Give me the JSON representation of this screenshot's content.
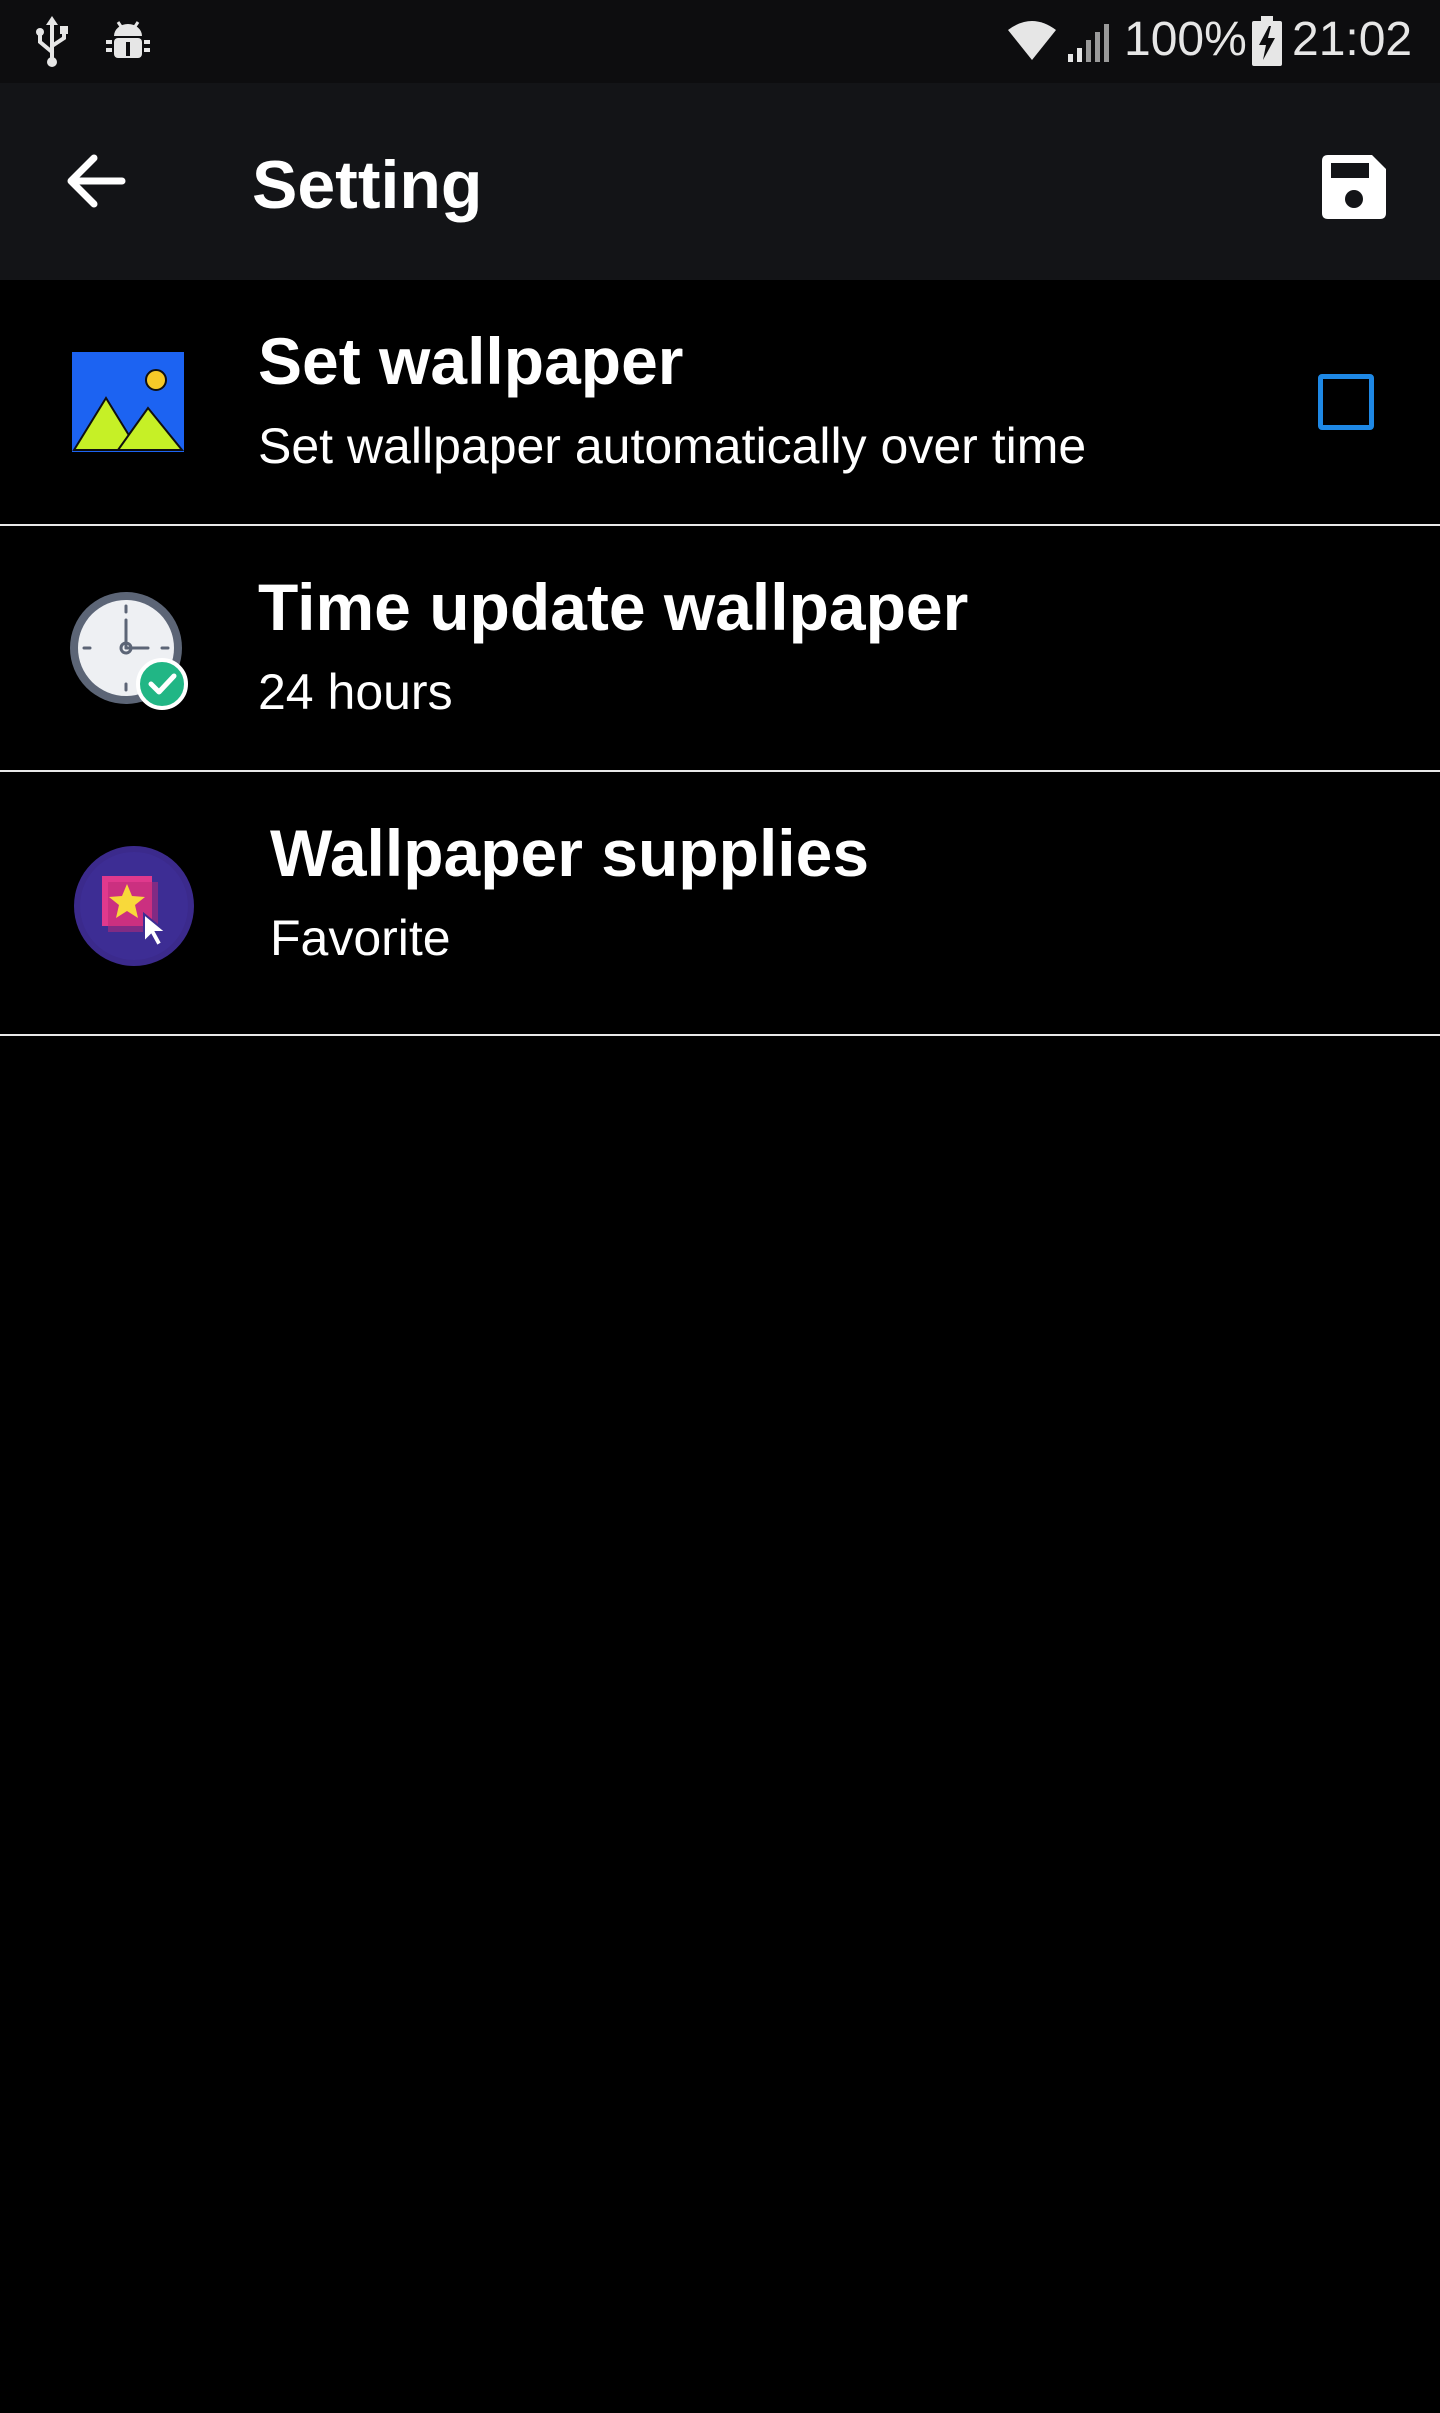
{
  "status_bar": {
    "left_icons": [
      "usb-icon",
      "android-debug-icon"
    ],
    "right_icons": [
      "wifi-icon",
      "signal-icon",
      "battery-charging-icon"
    ],
    "battery": "100%",
    "time": "21:02"
  },
  "app_bar": {
    "title": "Setting",
    "back_icon": "arrow-left-icon",
    "save_icon": "floppy-disk-icon"
  },
  "settings": [
    {
      "id": "set-wallpaper",
      "icon": "picture-landscape-icon",
      "title": "Set wallpaper",
      "subtitle": "Set wallpaper automatically over time",
      "checked": false
    },
    {
      "id": "time-update",
      "icon": "clock-check-icon",
      "title": "Time update wallpaper",
      "subtitle": "24 hours"
    },
    {
      "id": "wallpaper-supplies",
      "icon": "star-picture-cursor-icon",
      "title": "Wallpaper supplies",
      "subtitle": "Favorite"
    }
  ],
  "colors": {
    "background": "#000000",
    "app_bar": "#131417",
    "status_bar": "#0d0d0f",
    "accent": "#1e88e5",
    "divider": "#e9e9e9"
  }
}
